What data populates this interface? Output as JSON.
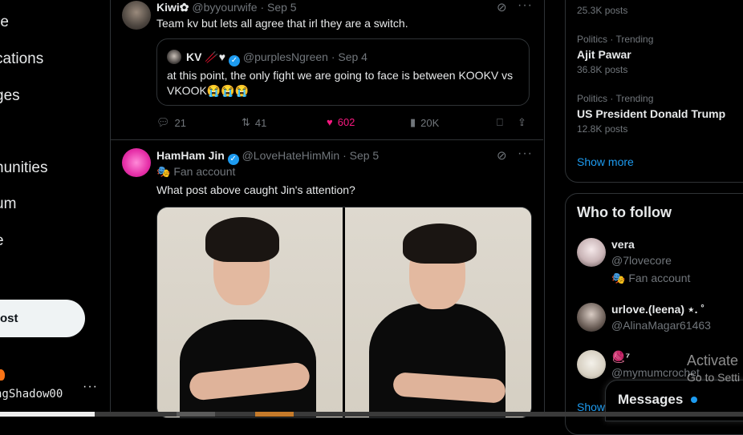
{
  "nav": {
    "items": [
      "re",
      "cations",
      "ges",
      "nunities",
      "um",
      "e"
    ],
    "post_label": "ost",
    "account_handle": "ngShadow00",
    "more": "···"
  },
  "tweets": [
    {
      "name": "Kiwi✿",
      "handle": "@byyourwife",
      "date": "· Sep 5",
      "text": "Team kv but lets all agree that irl they are a switch.",
      "quote": {
        "name": "KV 🥢♥",
        "handle": "@purplesNgreen",
        "date": "· Sep 4",
        "text": "at this point, the only fight we are going to face is between KOOKV vs VKOOK😭😭😭"
      },
      "actions": {
        "replies": "21",
        "reposts": "41",
        "likes": "602",
        "views": "20K"
      }
    },
    {
      "name": "HamHam Jin",
      "handle": "@LoveHateHimMin",
      "date": "· Sep 5",
      "badge": "🎭 Fan account",
      "text": "What post above caught Jin's attention?"
    }
  ],
  "trends": [
    {
      "count": "25.3K posts"
    },
    {
      "category": "Politics · Trending",
      "name": "Ajit Pawar",
      "count": "36.8K posts"
    },
    {
      "category": "Politics · Trending",
      "name": "US President Donald Trump",
      "count": "12.8K posts"
    }
  ],
  "show_more": "Show more",
  "who_to_follow": {
    "title": "Who to follow",
    "users": [
      {
        "name": "vera",
        "handle": "@7lovecore",
        "badge": "🎭 Fan account"
      },
      {
        "name": "urlove.(leena) ⋆. ˚",
        "handle": "@AlinaMagar61463"
      },
      {
        "name": "🧶⁷",
        "handle": "@mymumcrochet"
      }
    ],
    "show": "Show"
  },
  "messages": {
    "title": "Messages"
  },
  "activate": {
    "line1": "Activate",
    "line2": "Go to Setti"
  },
  "colors": {
    "accent": "#1d9bf0",
    "like": "#f91880",
    "background": "#000000"
  }
}
